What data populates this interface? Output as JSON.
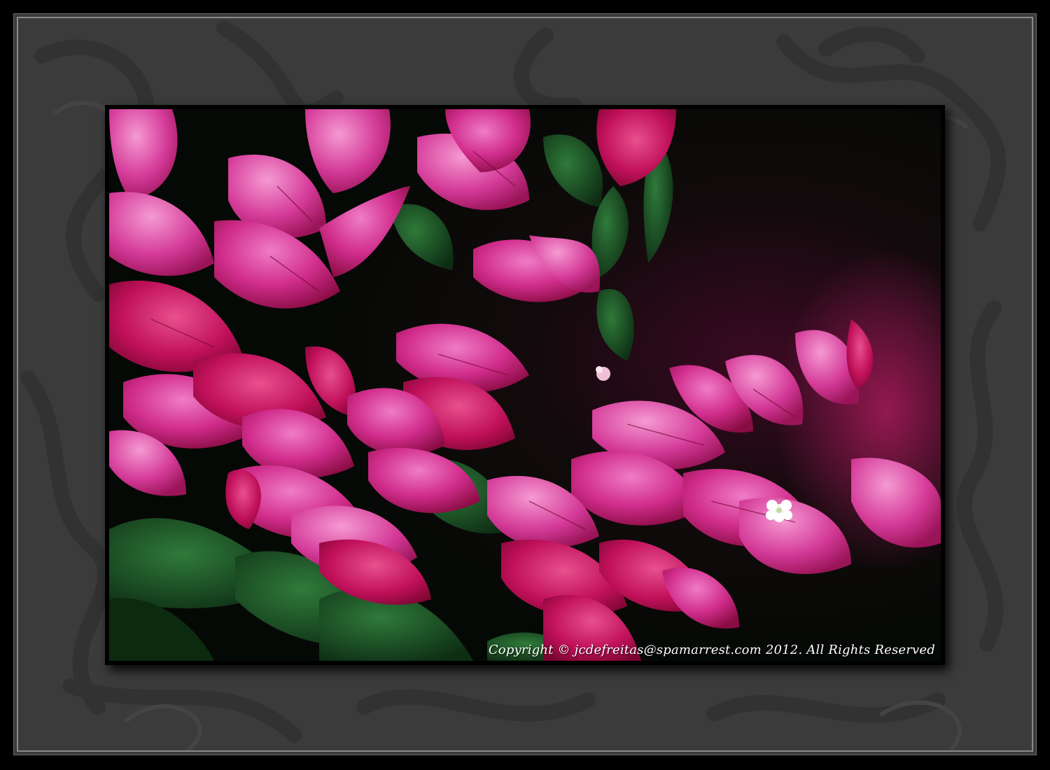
{
  "colors": {
    "mat": "#3b3b3b",
    "bract_primary": "#d42a8a",
    "bract_light": "#e05ab0",
    "bract_dark": "#a0104e",
    "leaf": "#1f5a2a",
    "background_dark": "#071007"
  },
  "photo": {
    "subject": "bougainvillea-flowers",
    "watermark": "Copyright © jcdefreitas@spamarrest.com 2012. All Rights Reserved"
  }
}
